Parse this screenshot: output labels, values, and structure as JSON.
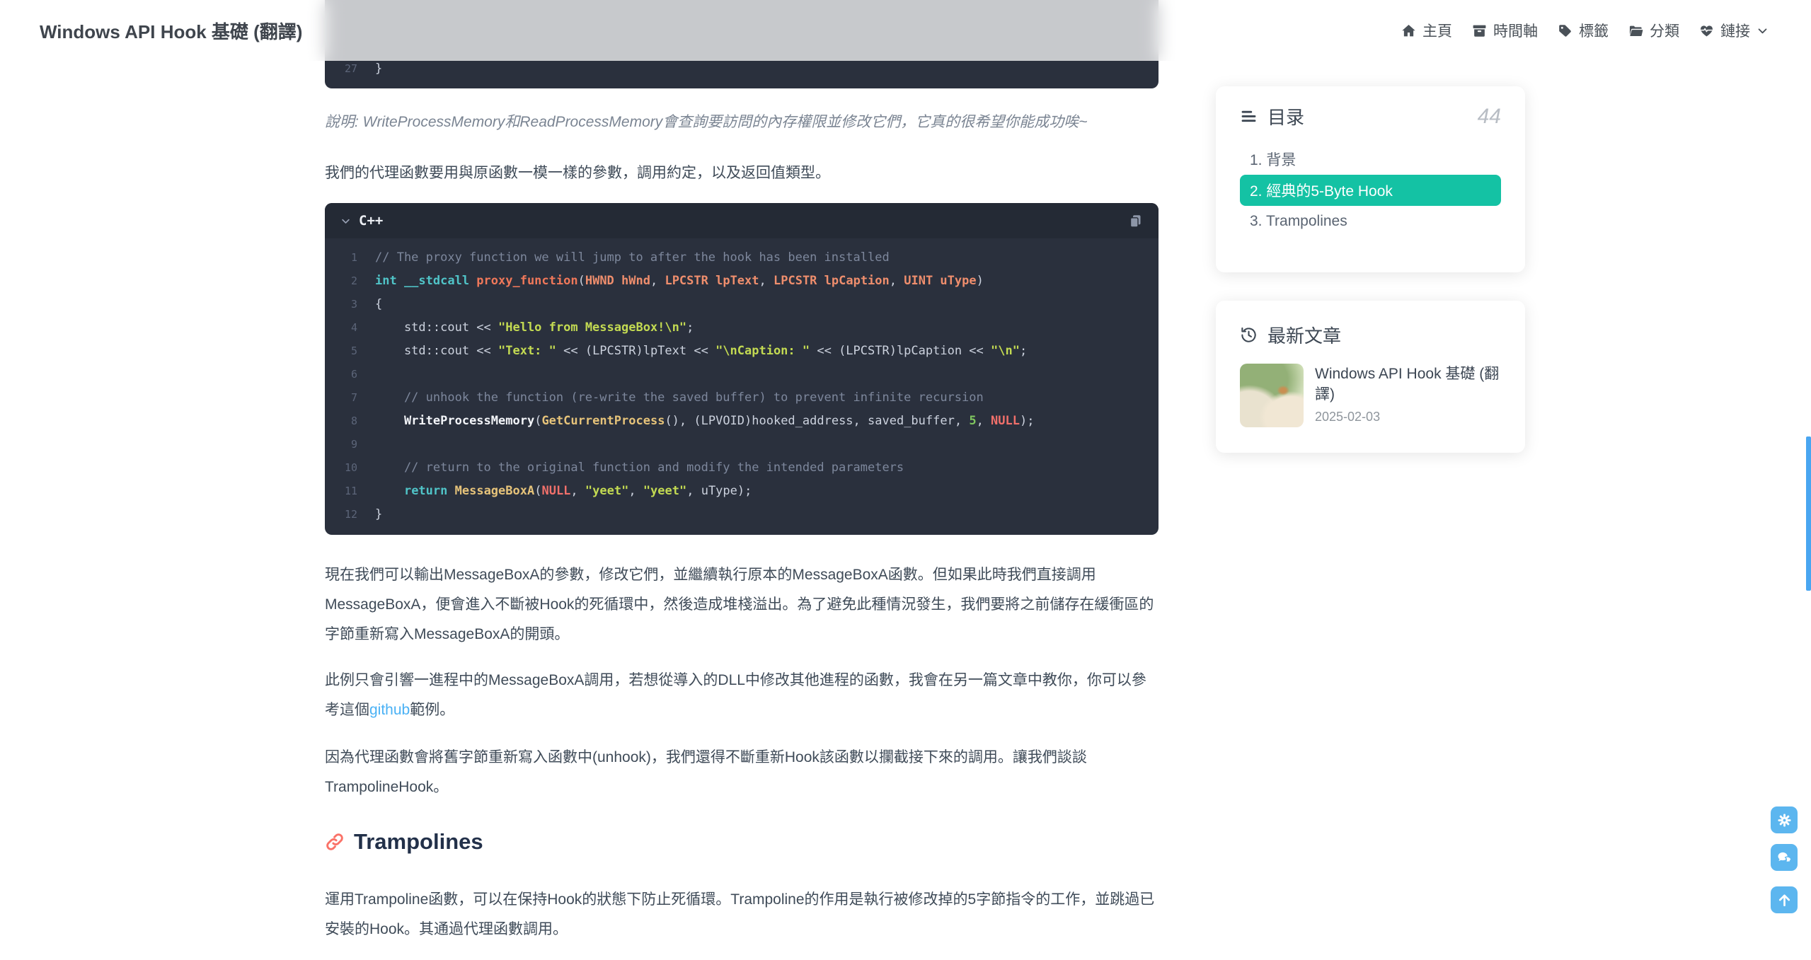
{
  "header": {
    "site_title": "Windows API Hook 基礎 (翻譯)",
    "nav": [
      {
        "label": "主頁",
        "icon": "home-icon"
      },
      {
        "label": "時間軸",
        "icon": "archive-icon"
      },
      {
        "label": "標籤",
        "icon": "tag-icon"
      },
      {
        "label": "分類",
        "icon": "folder-icon"
      },
      {
        "label": "鏈接",
        "icon": "heart-pulse-icon",
        "dropdown": true
      }
    ]
  },
  "article": {
    "trailing_code": {
      "lines": [
        {
          "n": "27",
          "s": [
            [
              "pln",
              "}"
            ]
          ]
        }
      ]
    },
    "note": "說明: WriteProcessMemory和ReadProcessMemory會查詢要訪問的內存權限並修改它們，它真的很希望你能成功唉~",
    "para_intro": "我們的代理函數要用與原函數一模一樣的參數，調用約定，以及返回值類型。",
    "code_block": {
      "language": "C++",
      "lines": [
        {
          "n": "1",
          "s": [
            [
              "cmt",
              "// The proxy function we will jump to after the hook has been installed"
            ]
          ]
        },
        {
          "n": "2",
          "s": [
            [
              "kw",
              "int __stdcall"
            ],
            [
              "fn",
              " proxy_function"
            ],
            [
              "pln",
              "("
            ],
            [
              "typ",
              "HWND hWnd"
            ],
            [
              "pln",
              ", "
            ],
            [
              "typ",
              "LPCSTR lpText"
            ],
            [
              "pln",
              ", "
            ],
            [
              "typ",
              "LPCSTR lpCaption"
            ],
            [
              "pln",
              ", "
            ],
            [
              "typ",
              "UINT uType"
            ],
            [
              "pln",
              ")"
            ]
          ]
        },
        {
          "n": "3",
          "s": [
            [
              "pln",
              "{"
            ]
          ]
        },
        {
          "n": "4",
          "s": [
            [
              "pln",
              "    std::cout << "
            ],
            [
              "str",
              "\"Hello from MessageBox!\\n\""
            ],
            [
              "pln",
              ";"
            ]
          ]
        },
        {
          "n": "5",
          "s": [
            [
              "pln",
              "    std::cout << "
            ],
            [
              "str",
              "\"Text: \""
            ],
            [
              "pln",
              " << (LPCSTR)lpText << "
            ],
            [
              "str",
              "\"\\nCaption: \""
            ],
            [
              "pln",
              " << (LPCSTR)lpCaption << "
            ],
            [
              "str",
              "\"\\n\""
            ],
            [
              "pln",
              ";"
            ]
          ]
        },
        {
          "n": "6",
          "s": []
        },
        {
          "n": "7",
          "s": [
            [
              "cmt",
              "    // unhook the function (re-write the saved buffer) to prevent infinite recursion"
            ]
          ]
        },
        {
          "n": "8",
          "s": [
            [
              "pln",
              "    "
            ],
            [
              "wfn",
              "WriteProcessMemory"
            ],
            [
              "pln",
              "("
            ],
            [
              "gfn",
              "GetCurrentProcess"
            ],
            [
              "pln",
              "(), (LPVOID)hooked_address, saved_buffer, "
            ],
            [
              "num",
              "5"
            ],
            [
              "pln",
              ", "
            ],
            [
              "nul",
              "NULL"
            ],
            [
              "pln",
              ");"
            ]
          ]
        },
        {
          "n": "9",
          "s": []
        },
        {
          "n": "10",
          "s": [
            [
              "cmt",
              "    // return to the original function and modify the intended parameters"
            ]
          ]
        },
        {
          "n": "11",
          "s": [
            [
              "pln",
              "    "
            ],
            [
              "kw",
              "return"
            ],
            [
              "pln",
              " "
            ],
            [
              "gfn",
              "MessageBoxA"
            ],
            [
              "pln",
              "("
            ],
            [
              "nul",
              "NULL"
            ],
            [
              "pln",
              ", "
            ],
            [
              "str",
              "\"yeet\""
            ],
            [
              "pln",
              ", "
            ],
            [
              "str",
              "\"yeet\""
            ],
            [
              "pln",
              ", uType);"
            ]
          ]
        },
        {
          "n": "12",
          "s": [
            [
              "pln",
              "}"
            ]
          ]
        }
      ]
    },
    "para_after_code": "現在我們可以輸出MessageBoxA的參數，修改它們，並繼續執行原本的MessageBoxA函數。但如果此時我們直接調用MessageBoxA，便會進入不斷被Hook的死循環中，然後造成堆棧溢出。為了避免此種情況發生，我們要將之前儲存在緩衝區的字節重新寫入MessageBoxA的開頭。",
    "para_github": {
      "before": "此例只會引響一進程中的MessageBoxA調用，若想從導入的DLL中修改其他進程的函數，我會在另一篇文章中教你，你可以參考這個",
      "link": "github",
      "after": "範例。"
    },
    "para_unhook": "因為代理函數會將舊字節重新寫入函數中(unhook)，我們還得不斷重新Hook該函數以攔截接下來的調用。讓我們談談TrampolineHook。",
    "section_heading": "Trampolines",
    "para_trampoline": "運用Trampoline函數，可以在保持Hook的狀態下防止死循環。Trampoline的作用是執行被修改掉的5字節指令的工作，並跳過已安裝的Hook。其通過代理函數調用。"
  },
  "sidebar": {
    "toc": {
      "title": "目录",
      "count": "44",
      "items": [
        {
          "label": "1. 背景",
          "active": false
        },
        {
          "label": "2. 經典的5-Byte Hook",
          "active": true
        },
        {
          "label": "3. Trampolines",
          "active": false
        }
      ]
    },
    "recent_posts": {
      "title": "最新文章",
      "posts": [
        {
          "title": "Windows API Hook 基礎 (翻譯)",
          "date": "2025-02-03"
        }
      ]
    }
  },
  "floating_buttons": [
    {
      "name": "settings-button",
      "icon": "gear-icon"
    },
    {
      "name": "comments-button",
      "icon": "chat-icon"
    },
    {
      "name": "back-to-top-button",
      "icon": "arrow-up-icon"
    }
  ],
  "colors": {
    "accent_teal": "#14c2a4",
    "link_blue": "#49b1f5",
    "fab_blue": "#5cb6ef",
    "heading_icon_coral": "#fa7268",
    "scrollbar_blue": "#49a6f1",
    "code_bg": "#2a303d"
  }
}
